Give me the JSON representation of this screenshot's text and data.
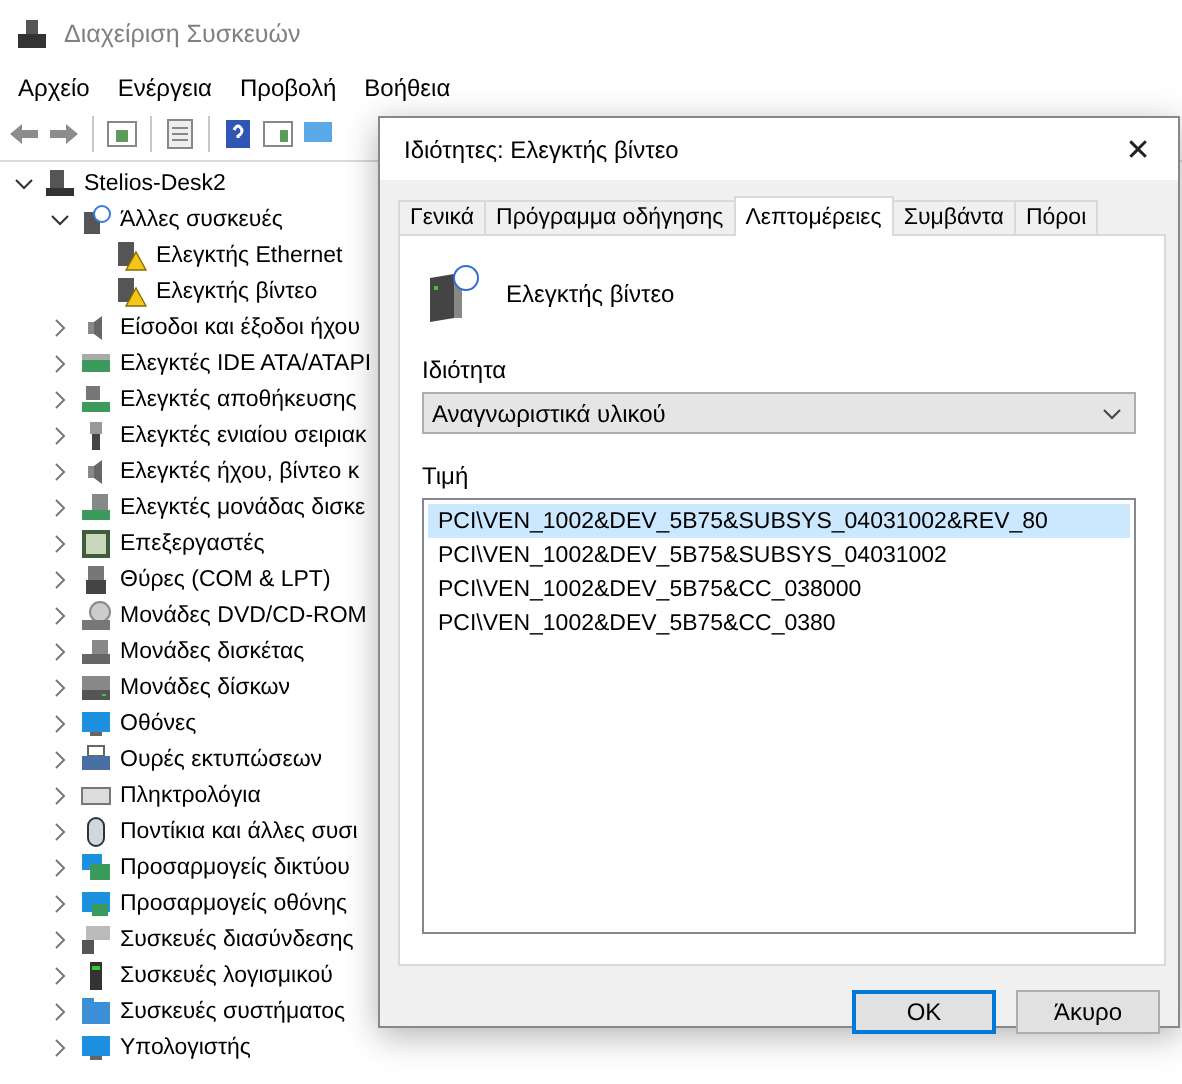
{
  "window": {
    "title": "Διαχείριση Συσκευών"
  },
  "menu": [
    "Αρχείο",
    "Ενέργεια",
    "Προβολή",
    "Βοήθεια"
  ],
  "tree": [
    {
      "label": "Stelios-Desk2",
      "expanded": true,
      "children": [
        {
          "label": "Άλλες συσκευές",
          "expanded": true,
          "children": [
            {
              "label": "Ελεγκτής Ethernet",
              "warning": true
            },
            {
              "label": "Ελεγκτής βίντεο",
              "warning": true
            }
          ]
        },
        {
          "label": "Είσοδοι και έξοδοι ήχου",
          "expanded": false
        },
        {
          "label": "Ελεγκτές IDE ATA/ATAPI",
          "expanded": false
        },
        {
          "label": "Ελεγκτές αποθήκευσης",
          "expanded": false
        },
        {
          "label": "Ελεγκτές ενιαίου σειριακ",
          "expanded": false
        },
        {
          "label": "Ελεγκτές ήχου, βίντεο κ",
          "expanded": false
        },
        {
          "label": "Ελεγκτές μονάδας δισκε",
          "expanded": false
        },
        {
          "label": "Επεξεργαστές",
          "expanded": false
        },
        {
          "label": "Θύρες (COM & LPT)",
          "expanded": false
        },
        {
          "label": "Μονάδες DVD/CD-ROM",
          "expanded": false
        },
        {
          "label": "Μονάδες δισκέτας",
          "expanded": false
        },
        {
          "label": "Μονάδες δίσκων",
          "expanded": false
        },
        {
          "label": "Οθόνες",
          "expanded": false
        },
        {
          "label": "Ουρές εκτυπώσεων",
          "expanded": false
        },
        {
          "label": "Πληκτρολόγια",
          "expanded": false
        },
        {
          "label": "Ποντίκια και άλλες συσι",
          "expanded": false
        },
        {
          "label": "Προσαρμογείς δικτύου",
          "expanded": false
        },
        {
          "label": "Προσαρμογείς οθόνης",
          "expanded": false
        },
        {
          "label": "Συσκευές διασύνδεσης",
          "expanded": false
        },
        {
          "label": "Συσκευές λογισμικού",
          "expanded": false
        },
        {
          "label": "Συσκευές συστήματος",
          "expanded": false
        },
        {
          "label": "Υπολογιστής",
          "expanded": false
        }
      ]
    }
  ],
  "dialog": {
    "title": "Ιδιότητες: Ελεγκτής βίντεο",
    "close": "✕",
    "tabs": [
      {
        "label": "Γενικά",
        "selected": false
      },
      {
        "label": "Πρόγραμμα οδήγησης",
        "selected": false
      },
      {
        "label": "Λεπτομέρειες",
        "selected": true
      },
      {
        "label": "Συμβάντα",
        "selected": false
      },
      {
        "label": "Πόροι",
        "selected": false
      }
    ],
    "device_name": "Ελεγκτής βίντεο",
    "property_label": "Ιδιότητα",
    "property_value": "Αναγνωριστικά υλικού",
    "value_label": "Τιμή",
    "values": [
      {
        "text": "PCI\\VEN_1002&DEV_5B75&SUBSYS_04031002&REV_80",
        "selected": true
      },
      {
        "text": "PCI\\VEN_1002&DEV_5B75&SUBSYS_04031002",
        "selected": false
      },
      {
        "text": "PCI\\VEN_1002&DEV_5B75&CC_038000",
        "selected": false
      },
      {
        "text": "PCI\\VEN_1002&DEV_5B75&CC_0380",
        "selected": false
      }
    ],
    "buttons": [
      {
        "label": "OK",
        "default": true
      },
      {
        "label": "Άκυρο",
        "default": false
      }
    ]
  }
}
